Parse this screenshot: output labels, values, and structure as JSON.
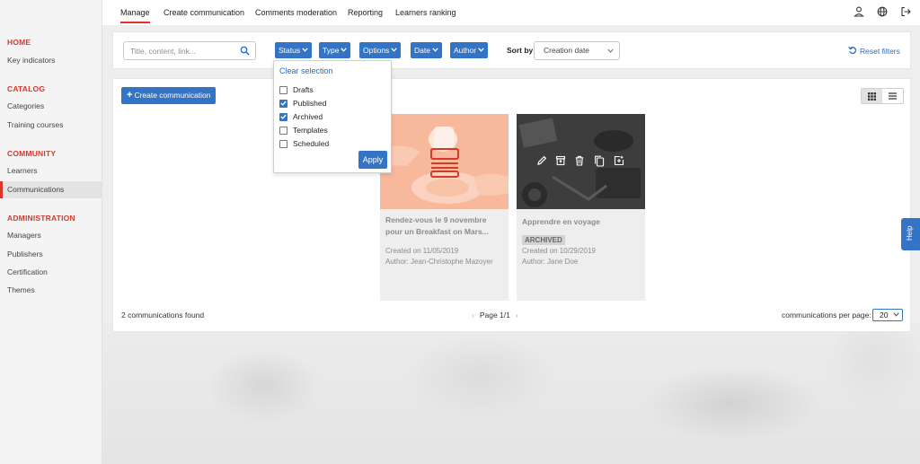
{
  "sidebar": {
    "sections": [
      {
        "title": "HOME",
        "items": [
          "Key indicators"
        ]
      },
      {
        "title": "CATALOG",
        "items": [
          "Categories",
          "Training courses"
        ]
      },
      {
        "title": "COMMUNITY",
        "items": [
          "Learners",
          "Communications"
        ]
      },
      {
        "title": "ADMINISTRATION",
        "items": [
          "Managers",
          "Publishers",
          "Certification",
          "Themes"
        ]
      }
    ],
    "active_item": "Communications"
  },
  "topnav": {
    "tabs": [
      "Manage",
      "Create communication",
      "Comments moderation",
      "Reporting",
      "Learners ranking"
    ],
    "active_tab": "Manage",
    "icons": [
      "user-icon",
      "globe-icon",
      "logout-icon"
    ]
  },
  "filters": {
    "search_placeholder": "Title, content, link...",
    "search_value": "",
    "buttons": [
      "Status",
      "Type",
      "Options",
      "Date",
      "Author"
    ],
    "sort_label": "Sort by:",
    "sort_value": "Creation date",
    "reset_label": "Reset filters"
  },
  "status_dropdown": {
    "clear_label": "Clear selection",
    "options": [
      {
        "label": "Drafts",
        "checked": false
      },
      {
        "label": "Published",
        "checked": true
      },
      {
        "label": "Archived",
        "checked": true
      },
      {
        "label": "Templates",
        "checked": false
      },
      {
        "label": "Scheduled",
        "checked": false
      }
    ],
    "apply_label": "Apply"
  },
  "content": {
    "create_label": "Create communication",
    "view_modes": [
      "grid",
      "list"
    ],
    "active_view": "grid",
    "cards": [
      {
        "title": "Rendez-vous le 9 novembre pour un Breakfast on Mars...",
        "created": "Created on 11/05/2019",
        "author": "Author: Jean-Christophe Mazoyer",
        "badge": ""
      },
      {
        "title": "Apprendre en voyage",
        "badge": "ARCHIVED",
        "created": "Created on 10/29/2019",
        "author": "Author: Jane Doe",
        "actions": [
          "edit-icon",
          "archive-icon",
          "delete-icon",
          "copy-icon",
          "add-icon"
        ]
      }
    ],
    "found_text": "2 communications found",
    "page_text": "Page 1/1",
    "per_page_label": "communications per page:",
    "per_page_value": "20"
  },
  "help_label": "Help",
  "colors": {
    "accent": "#d9372a",
    "primary": "#3374c6",
    "link": "#2b6cc4"
  }
}
